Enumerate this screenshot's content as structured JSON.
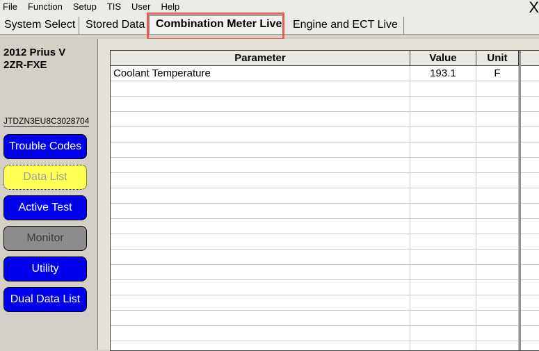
{
  "menu": {
    "items": [
      "File",
      "Function",
      "Setup",
      "TIS",
      "User",
      "Help"
    ],
    "close_glyph": "X"
  },
  "tabs": [
    {
      "label": "System Select",
      "active": false
    },
    {
      "label": "Stored Data",
      "active": false
    },
    {
      "label": "Combination Meter Live",
      "active": true
    },
    {
      "label": "Engine and ECT Live",
      "active": false
    }
  ],
  "vehicle": {
    "model": "2012 Prius V",
    "engine": "2ZR-FXE",
    "vin": "JTDZN3EU8C3028704"
  },
  "sidebar": {
    "buttons": [
      {
        "label": "Trouble Codes",
        "state": "enabled"
      },
      {
        "label": "Data List",
        "state": "selected"
      },
      {
        "label": "Active Test",
        "state": "enabled"
      },
      {
        "label": "Monitor",
        "state": "disabled"
      },
      {
        "label": "Utility",
        "state": "enabled"
      },
      {
        "label": "Dual Data List",
        "state": "enabled"
      }
    ]
  },
  "table": {
    "headers": {
      "parameter": "Parameter",
      "value": "Value",
      "unit": "Unit"
    },
    "rows": [
      {
        "parameter": "Coolant Temperature",
        "value": "193.1",
        "unit": "F"
      }
    ]
  },
  "colors": {
    "highlight_box": "#e06050",
    "button_blue": "#0000ee",
    "button_selected": "#ffff55",
    "button_disabled": "#8c8c8c"
  }
}
